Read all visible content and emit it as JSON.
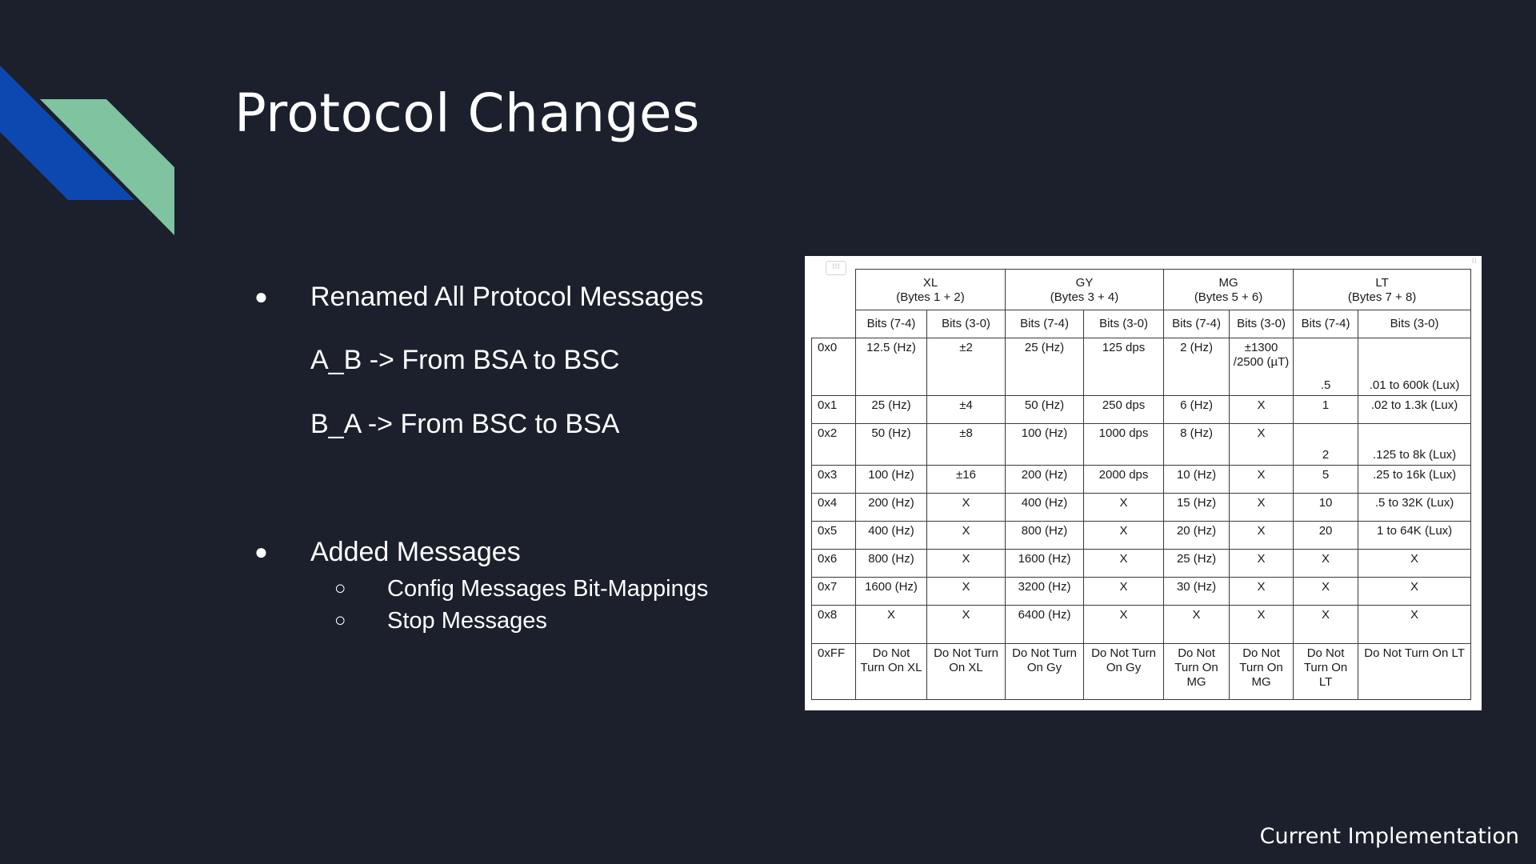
{
  "slide": {
    "title": "Protocol Changes",
    "footer": "Current Implementation",
    "accent_colors": {
      "background": "#1b202c",
      "stripe_blue": "#0d47b0",
      "stripe_green": "#7fc3a0"
    }
  },
  "bullets": [
    {
      "marker": "●",
      "text": "Renamed All Protocol Messages"
    },
    {
      "marker": "",
      "text": "A_B -> From BSA to BSC"
    },
    {
      "marker": "",
      "text": "B_A -> From BSC to BSA"
    },
    {
      "marker": "●",
      "text": "Added Messages"
    }
  ],
  "sub_bullets": [
    {
      "marker": "○",
      "text": "Config Messages Bit-Mappings"
    },
    {
      "marker": "○",
      "text": "Stop Messages"
    }
  ],
  "table": {
    "groups": [
      {
        "name": "XL",
        "bytes": "(Bytes 1 + 2)"
      },
      {
        "name": "GY",
        "bytes": "(Bytes 3 + 4)"
      },
      {
        "name": "MG",
        "bytes": "(Bytes 5 + 6)"
      },
      {
        "name": "LT",
        "bytes": "(Bytes 7 + 8)"
      }
    ],
    "subheaders": [
      "Bits (7-4)",
      "Bits (3-0)",
      "Bits (7-4)",
      "Bits (3-0)",
      "Bits (7-4)",
      "Bits (3-0)",
      "Bits (7-4)",
      "Bits (3-0)"
    ],
    "rows": [
      {
        "code": "0x0",
        "cells": [
          "12.5 (Hz)",
          "±2",
          "25 (Hz)",
          "125 dps",
          "2 (Hz)",
          "±1300 /2500 (µT)",
          ".5",
          ".01 to 600k (Lux)"
        ]
      },
      {
        "code": "0x1",
        "cells": [
          "25 (Hz)",
          "±4",
          "50 (Hz)",
          "250 dps",
          "6 (Hz)",
          "X",
          "1",
          ".02 to 1.3k (Lux)"
        ]
      },
      {
        "code": "0x2",
        "cells": [
          "50 (Hz)",
          "±8",
          "100 (Hz)",
          "1000 dps",
          "8 (Hz)",
          "X",
          "2",
          ".125 to 8k (Lux)"
        ]
      },
      {
        "code": "0x3",
        "cells": [
          "100 (Hz)",
          "±16",
          "200 (Hz)",
          "2000 dps",
          "10 (Hz)",
          "X",
          "5",
          ".25 to 16k (Lux)"
        ]
      },
      {
        "code": "0x4",
        "cells": [
          "200 (Hz)",
          "X",
          "400 (Hz)",
          "X",
          "15 (Hz)",
          "X",
          "10",
          ".5 to 32K (Lux)"
        ]
      },
      {
        "code": "0x5",
        "cells": [
          "400 (Hz)",
          "X",
          "800 (Hz)",
          "X",
          "20 (Hz)",
          "X",
          "20",
          "1 to 64K (Lux)"
        ]
      },
      {
        "code": "0x6",
        "cells": [
          "800 (Hz)",
          "X",
          "1600 (Hz)",
          "X",
          "25 (Hz)",
          "X",
          "X",
          "X"
        ]
      },
      {
        "code": "0x7",
        "cells": [
          "1600 (Hz)",
          "X",
          "3200 (Hz)",
          "X",
          "30 (Hz)",
          "X",
          "X",
          "X"
        ]
      },
      {
        "code": "0x8",
        "cells": [
          "X",
          "X",
          "6400 (Hz)",
          "X",
          "X",
          "X",
          "X",
          "X"
        ]
      },
      {
        "code": "0xFF",
        "cells": [
          "Do Not Turn On XL",
          "Do Not Turn On XL",
          "Do Not Turn On Gy",
          "Do Not Turn On Gy",
          "Do Not Turn On MG",
          "Do Not Turn On MG",
          "Do Not Turn On LT",
          "Do Not Turn On LT"
        ]
      }
    ]
  }
}
